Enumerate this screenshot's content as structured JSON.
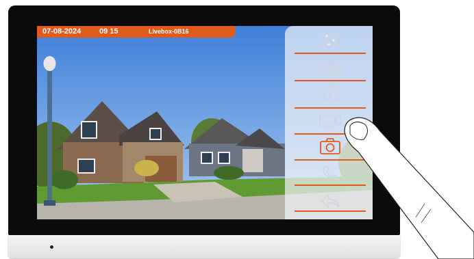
{
  "status_bar": {
    "date": "07-08-2024",
    "time": "09 15",
    "network": "Livebox-0B16"
  },
  "menu": {
    "items": [
      {
        "name": "settings-sliders",
        "icon": "sliders-icon"
      },
      {
        "name": "gate",
        "icon": "gate-icon"
      },
      {
        "name": "door-unlock",
        "icon": "padlock-icon"
      },
      {
        "name": "video-record",
        "icon": "video-camera-icon"
      },
      {
        "name": "photo-capture",
        "icon": "camera-icon",
        "active": true
      },
      {
        "name": "call",
        "icon": "phone-icon"
      },
      {
        "name": "back",
        "icon": "back-arrow-icon"
      }
    ]
  },
  "colors": {
    "accent": "#e05a1c",
    "menu_icon": "#d0d4da",
    "bezel": "#0b0b0b"
  }
}
